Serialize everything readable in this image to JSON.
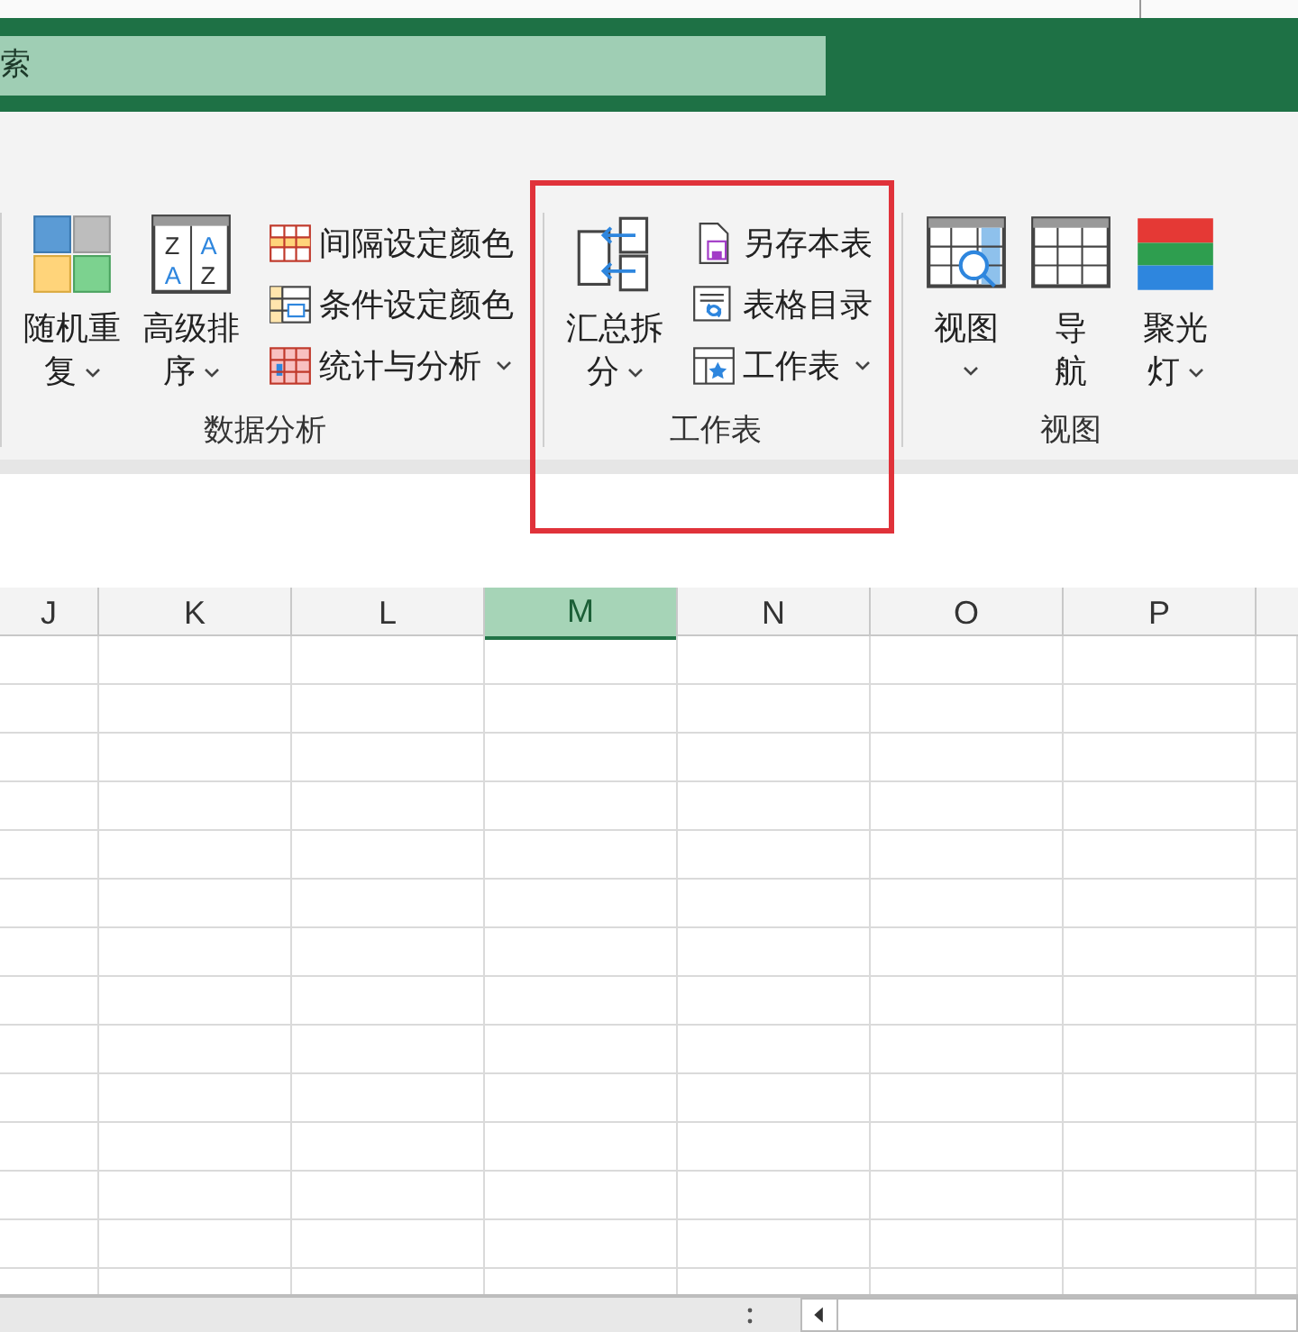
{
  "search": {
    "placeholder": "索"
  },
  "ribbon": {
    "groups": [
      {
        "label": "数据分析",
        "large": [
          {
            "kind": "tiles",
            "lines": [
              "随机重",
              "复"
            ],
            "dropdown": true
          },
          {
            "kind": "sort",
            "lines": [
              "高级排",
              "序"
            ],
            "dropdown": true,
            "letters": [
              "Z",
              "A",
              "A",
              "Z"
            ]
          }
        ],
        "small": [
          {
            "kind": "stripes",
            "label": "间隔设定颜色",
            "dropdown": false
          },
          {
            "kind": "cond",
            "label": "条件设定颜色",
            "dropdown": false
          },
          {
            "kind": "stats",
            "label": "统计与分析",
            "dropdown": true
          }
        ],
        "highlighted": false
      },
      {
        "label": "工作表",
        "large": [
          {
            "kind": "split",
            "lines": [
              "汇总拆",
              "分"
            ],
            "dropdown": true
          }
        ],
        "small": [
          {
            "kind": "save",
            "label": "另存本表",
            "dropdown": false
          },
          {
            "kind": "toc",
            "label": "表格目录",
            "dropdown": false
          },
          {
            "kind": "sheet",
            "label": "工作表",
            "dropdown": true
          }
        ],
        "highlighted": true
      },
      {
        "label": "视图",
        "large": [
          {
            "kind": "view",
            "lines": [
              "视图"
            ],
            "dropdown": true
          },
          {
            "kind": "grid",
            "lines": [
              "导",
              "航"
            ],
            "dropdown": false
          },
          {
            "kind": "spot",
            "lines": [
              "聚光",
              "灯"
            ],
            "dropdown": true
          }
        ],
        "highlighted": false
      }
    ]
  },
  "columns": [
    {
      "label": "J",
      "selected": false
    },
    {
      "label": "K",
      "selected": false
    },
    {
      "label": "L",
      "selected": false
    },
    {
      "label": "M",
      "selected": true
    },
    {
      "label": "N",
      "selected": false
    },
    {
      "label": "O",
      "selected": false
    },
    {
      "label": "P",
      "selected": false
    }
  ]
}
